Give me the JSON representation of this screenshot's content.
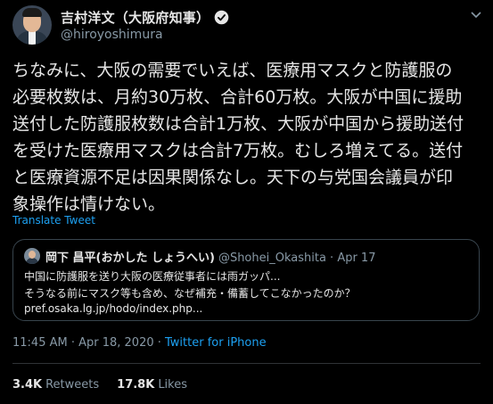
{
  "author": {
    "display_name": "吉村洋文（大阪府知事）",
    "handle": "@hiroyoshimura",
    "verified_icon": "verified-badge-icon"
  },
  "tweet": {
    "text": "ちなみに、大阪の需要でいえば、医療用マスクと防護服の\n必要枚数は、月約30万枚、合計60万枚。大阪が中国に援助\n送付した防護服枚数は合計1万枚、大阪が中国から援助送付\nを受けた医療用マスクは合計7万枚。むしろ増えてる。送付\nと医療資源不足は因果関係なし。天下の与党国会議員が印\n象操作は情けない。",
    "translate_label": "Translate Tweet"
  },
  "quoted": {
    "name": "岡下 昌平(おかした しょうへい)",
    "handle_date": "@Shohei_Okashita · Apr 17",
    "line1": "中国に防護服を送り大阪の医療従事者には雨ガッパ...",
    "line2": "そうなる前にマスク等も含め、なぜ補充・備蓄してこなかったのか？",
    "line3": "pref.osaka.lg.jp/hodo/index.php..."
  },
  "meta": {
    "timestamp": "11:45 AM · Apr 18, 2020 · ",
    "source": "Twitter for iPhone"
  },
  "stats": {
    "retweets_count": "3.4K",
    "retweets_label": "Retweets",
    "likes_count": "17.8K",
    "likes_label": "Likes"
  },
  "colors": {
    "background": "#000000",
    "link": "#1da1f2",
    "secondary": "#8899a6",
    "border": "#38444d"
  }
}
